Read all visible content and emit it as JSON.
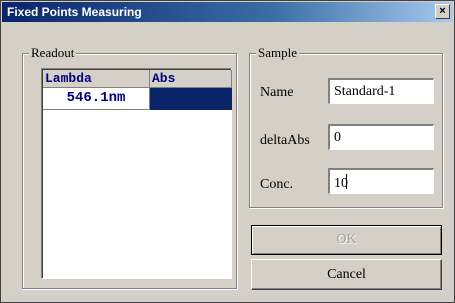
{
  "window": {
    "title": "Fixed Points Measuring",
    "close_label": "×"
  },
  "readout": {
    "group_label": "Readout",
    "columns": [
      "Lambda",
      "Abs"
    ],
    "rows": [
      {
        "lambda": "546.1nm",
        "abs": ""
      }
    ]
  },
  "sample": {
    "group_label": "Sample",
    "name_label": "Name",
    "name_value": "Standard-1",
    "delta_label": "deltaAbs",
    "delta_value": "0",
    "conc_label": "Conc.",
    "conc_value": "10"
  },
  "buttons": {
    "ok": "OK",
    "cancel": "Cancel"
  },
  "colors": {
    "title_gradient_start": "#0a246a",
    "selection": "#0a246a",
    "list_text": "#000080",
    "face": "#d4d0c8"
  }
}
